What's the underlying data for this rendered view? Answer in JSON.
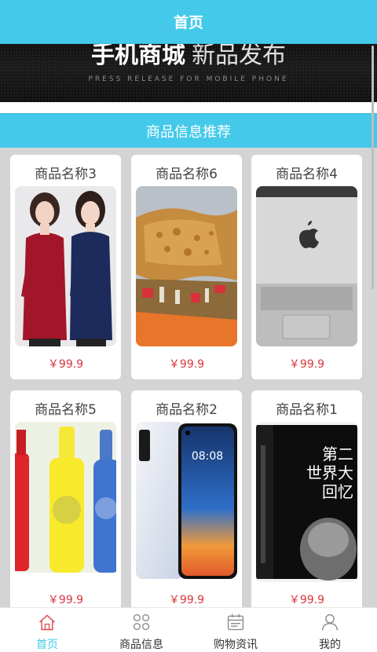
{
  "header": {
    "title": "首页"
  },
  "banner": {
    "title_strong": "手机商城",
    "title_light": "新品发布",
    "subtitle": "PRESS RELEASE FOR MOBILE PHONE"
  },
  "section": {
    "title": "商品信息推荐"
  },
  "products": [
    {
      "name": "商品名称3",
      "price": "￥99.9",
      "image": "two-women-clothing"
    },
    {
      "name": "商品名称6",
      "price": "￥99.9",
      "image": "fried-food"
    },
    {
      "name": "商品名称4",
      "price": "￥99.9",
      "image": "laptop"
    },
    {
      "name": "商品名称5",
      "price": "￥99.9",
      "image": "bottles"
    },
    {
      "name": "商品名称2",
      "price": "￥99.9",
      "image": "phone"
    },
    {
      "name": "商品名称1",
      "price": "￥99.9",
      "image": "book"
    }
  ],
  "phone_screen_time": "08:08",
  "book": {
    "title_line1": "第二",
    "title_line2": "世界大",
    "title_line3": "回忆"
  },
  "tabbar": {
    "items": [
      {
        "label": "首页",
        "icon": "home-icon",
        "active": true
      },
      {
        "label": "商品信息",
        "icon": "grid-icon",
        "active": false
      },
      {
        "label": "购物资讯",
        "icon": "calendar-icon",
        "active": false
      },
      {
        "label": "我的",
        "icon": "user-icon",
        "active": false
      }
    ]
  },
  "colors": {
    "accent": "#44c9ea",
    "price": "#d6363d"
  }
}
